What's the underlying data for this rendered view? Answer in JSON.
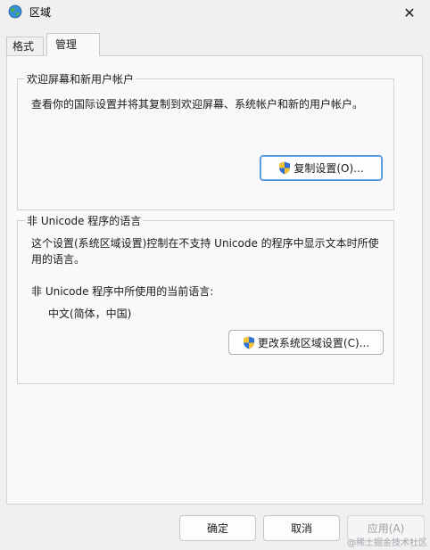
{
  "window": {
    "title": "区域",
    "close_glyph": "✕"
  },
  "tabs": [
    {
      "label": "格式",
      "selected": false
    },
    {
      "label": "管理",
      "selected": true
    }
  ],
  "welcome_group": {
    "legend": "欢迎屏幕和新用户帐户",
    "description": "查看你的国际设置并将其复制到欢迎屏幕、系统帐户和新的用户帐户。",
    "copy_button_label": "复制设置(O)..."
  },
  "nonunicode_group": {
    "legend": "非 Unicode 程序的语言",
    "description": "这个设置(系统区域设置)控制在不支持 Unicode 的程序中显示文本时所使用的语言。",
    "current_label": "非 Unicode 程序中所使用的当前语言:",
    "current_value": "中文(简体，中国)",
    "change_button_label": "更改系统区域设置(C)..."
  },
  "footer": {
    "ok_label": "确定",
    "cancel_label": "取消",
    "apply_label": "应用(A)"
  },
  "watermark": "@稀土掘金技术社区",
  "colors": {
    "accent_border": "#4a8fd8",
    "shield_blue": "#2f6fd6",
    "shield_yellow": "#f2c230"
  },
  "icons": {
    "app": "globe-icon",
    "shield": "uac-shield-icon",
    "close": "close-icon"
  }
}
